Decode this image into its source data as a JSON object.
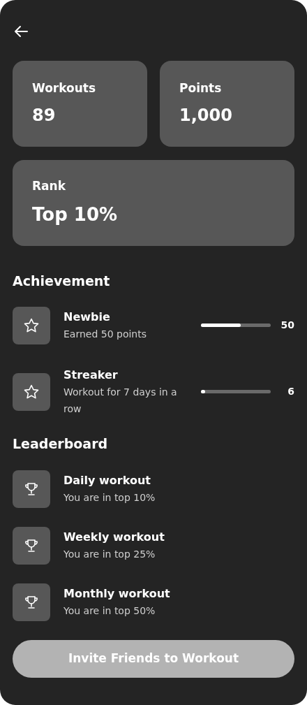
{
  "stats": [
    {
      "label": "Workouts",
      "value": "89"
    },
    {
      "label": "Points",
      "value": "1,000"
    },
    {
      "label": "Rank",
      "value": "Top 10%"
    }
  ],
  "achievement": {
    "title": "Achievement",
    "items": [
      {
        "name": "Newbie",
        "description": "Earned 50 points",
        "level": 0.57,
        "reading": "50"
      },
      {
        "name": "Streaker",
        "description": "Workout for 7 days in a row",
        "level": 0.06,
        "reading": "6"
      }
    ]
  },
  "leaderboard": {
    "title": "Leaderboard",
    "items": [
      {
        "name": "Daily workout",
        "description": "You are in top 10%"
      },
      {
        "name": "Weekly workout",
        "description": "You are in top 25%"
      },
      {
        "name": "Monthly workout",
        "description": "You are in top 50%"
      }
    ]
  },
  "button": {
    "label": "Invite Friends to Workout"
  }
}
